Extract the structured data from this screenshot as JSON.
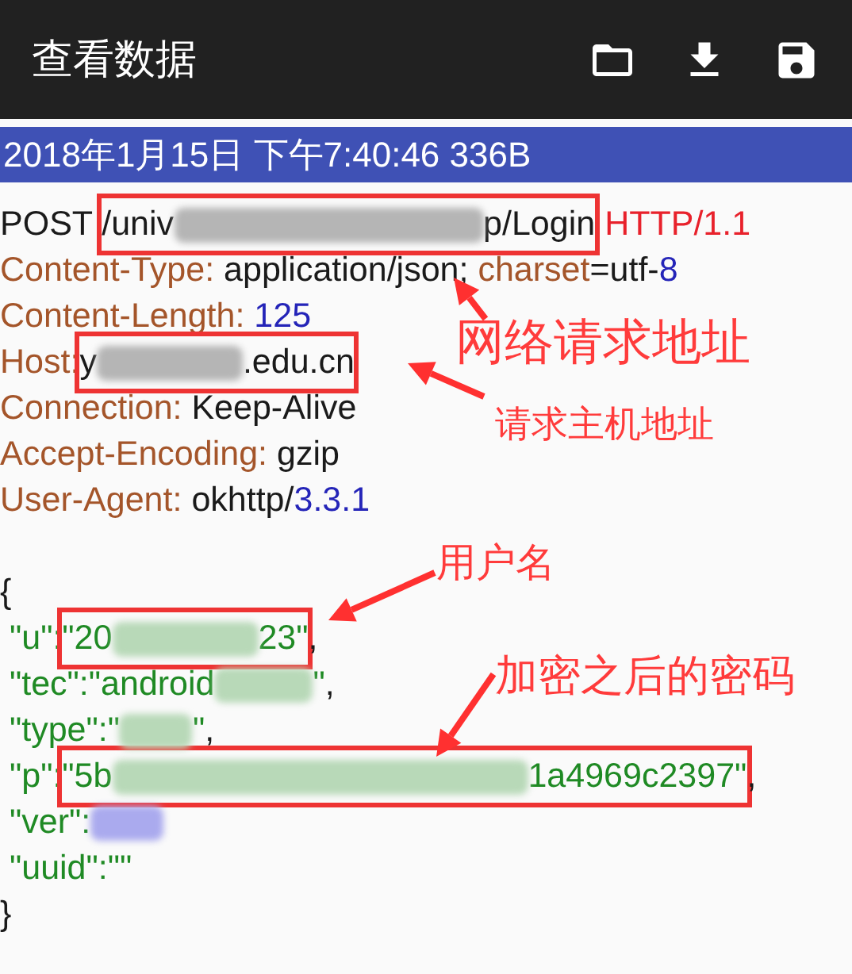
{
  "app_bar": {
    "title": "查看数据"
  },
  "record_bar": {
    "text": "2018年1月15日 下午7:40:46 336B"
  },
  "request_lines": [
    {
      "segments": [
        {
          "kind": "text",
          "color": "#1a1a1a",
          "text": "POST "
        },
        {
          "kind": "boxed",
          "segments": [
            {
              "kind": "text",
              "color": "#1a1a1a",
              "text": "/univ"
            },
            {
              "kind": "redacted-l",
              "color": "#b5b5b5"
            },
            {
              "kind": "text",
              "color": "#1a1a1a",
              "text": "p/Login"
            }
          ]
        },
        {
          "kind": "text",
          "color": "#e8212b",
          "text": " HTTP/1.1"
        }
      ]
    },
    {
      "segments": [
        {
          "kind": "text",
          "color": "#a4552a",
          "text": "Content-Type: "
        },
        {
          "kind": "text",
          "color": "#1a1a1a",
          "text": "application/json; "
        },
        {
          "kind": "text",
          "color": "#a4552a",
          "text": "charset"
        },
        {
          "kind": "text",
          "color": "#1a1a1a",
          "text": "=utf-"
        },
        {
          "kind": "text",
          "color": "#2424b8",
          "text": "8"
        }
      ]
    },
    {
      "segments": [
        {
          "kind": "text",
          "color": "#a4552a",
          "text": "Content-Length: "
        },
        {
          "kind": "text",
          "color": "#2424b8",
          "text": "125"
        }
      ]
    },
    {
      "segments": [
        {
          "kind": "text",
          "color": "#a4552a",
          "text": "Host:"
        },
        {
          "kind": "boxed",
          "segments": [
            {
              "kind": "text",
              "color": "#1a1a1a",
              "text": "y"
            },
            {
              "kind": "redacted-m",
              "color": "#b5b5b5"
            },
            {
              "kind": "text",
              "color": "#1a1a1a",
              "text": ".edu.cn"
            }
          ]
        }
      ]
    },
    {
      "segments": [
        {
          "kind": "text",
          "color": "#a4552a",
          "text": "Connection: "
        },
        {
          "kind": "text",
          "color": "#1a1a1a",
          "text": "Keep-Alive"
        }
      ]
    },
    {
      "segments": [
        {
          "kind": "text",
          "color": "#a4552a",
          "text": "Accept-Encoding: "
        },
        {
          "kind": "text",
          "color": "#1a1a1a",
          "text": "gzip"
        }
      ]
    },
    {
      "segments": [
        {
          "kind": "text",
          "color": "#a4552a",
          "text": "User-Agent: "
        },
        {
          "kind": "text",
          "color": "#1a1a1a",
          "text": "okhttp/"
        },
        {
          "kind": "text",
          "color": "#2424b8",
          "text": "3.3.1"
        }
      ]
    }
  ],
  "body_lines": [
    {
      "segments": [
        {
          "kind": "text",
          "color": "#1a1a1a",
          "text": "{"
        }
      ]
    },
    {
      "segments": [
        {
          "kind": "text",
          "color": "#1f8a24",
          "text": " \"u\":"
        },
        {
          "kind": "boxed",
          "segments": [
            {
              "kind": "text",
              "color": "#1f8a24",
              "text": "\"20"
            },
            {
              "kind": "redacted-m",
              "color": "#b8d9b8"
            },
            {
              "kind": "text",
              "color": "#1f8a24",
              "text": "23\""
            }
          ]
        },
        {
          "kind": "text",
          "color": "#1a1a1a",
          "text": ","
        }
      ]
    },
    {
      "segments": [
        {
          "kind": "text",
          "color": "#1f8a24",
          "text": " \"tec\":\"android"
        },
        {
          "kind": "redacted-s",
          "color": "#b8d9b8"
        },
        {
          "kind": "text",
          "color": "#1f8a24",
          "text": "\""
        },
        {
          "kind": "text",
          "color": "#1a1a1a",
          "text": ","
        }
      ]
    },
    {
      "segments": [
        {
          "kind": "text",
          "color": "#1f8a24",
          "text": " \"type\":\""
        },
        {
          "kind": "redacted-xs",
          "color": "#b8d9b8"
        },
        {
          "kind": "text",
          "color": "#1f8a24",
          "text": "\""
        },
        {
          "kind": "text",
          "color": "#1a1a1a",
          "text": ","
        }
      ]
    },
    {
      "segments": [
        {
          "kind": "text",
          "color": "#1f8a24",
          "text": " \"p\":"
        },
        {
          "kind": "boxed",
          "segments": [
            {
              "kind": "text",
              "color": "#1f8a24",
              "text": "\"5b"
            },
            {
              "kind": "redacted-xl",
              "color": "#b8d9b8"
            },
            {
              "kind": "text",
              "color": "#1f8a24",
              "text": "1a4969c2397\""
            }
          ]
        },
        {
          "kind": "text",
          "color": "#1a1a1a",
          "text": ","
        }
      ]
    },
    {
      "segments": [
        {
          "kind": "text",
          "color": "#1f8a24",
          "text": " \"ver\":"
        },
        {
          "kind": "redacted-xs",
          "color": "#aaaaee"
        }
      ]
    },
    {
      "segments": [
        {
          "kind": "text",
          "color": "#1f8a24",
          "text": " \"uuid\":\"\""
        }
      ]
    },
    {
      "segments": [
        {
          "kind": "text",
          "color": "#1a1a1a",
          "text": "}"
        }
      ]
    }
  ],
  "annotations": [
    {
      "text": "网络请求地址"
    },
    {
      "text": "请求主机地址"
    },
    {
      "text": "用户名"
    },
    {
      "text": "加密之后的密码"
    }
  ]
}
